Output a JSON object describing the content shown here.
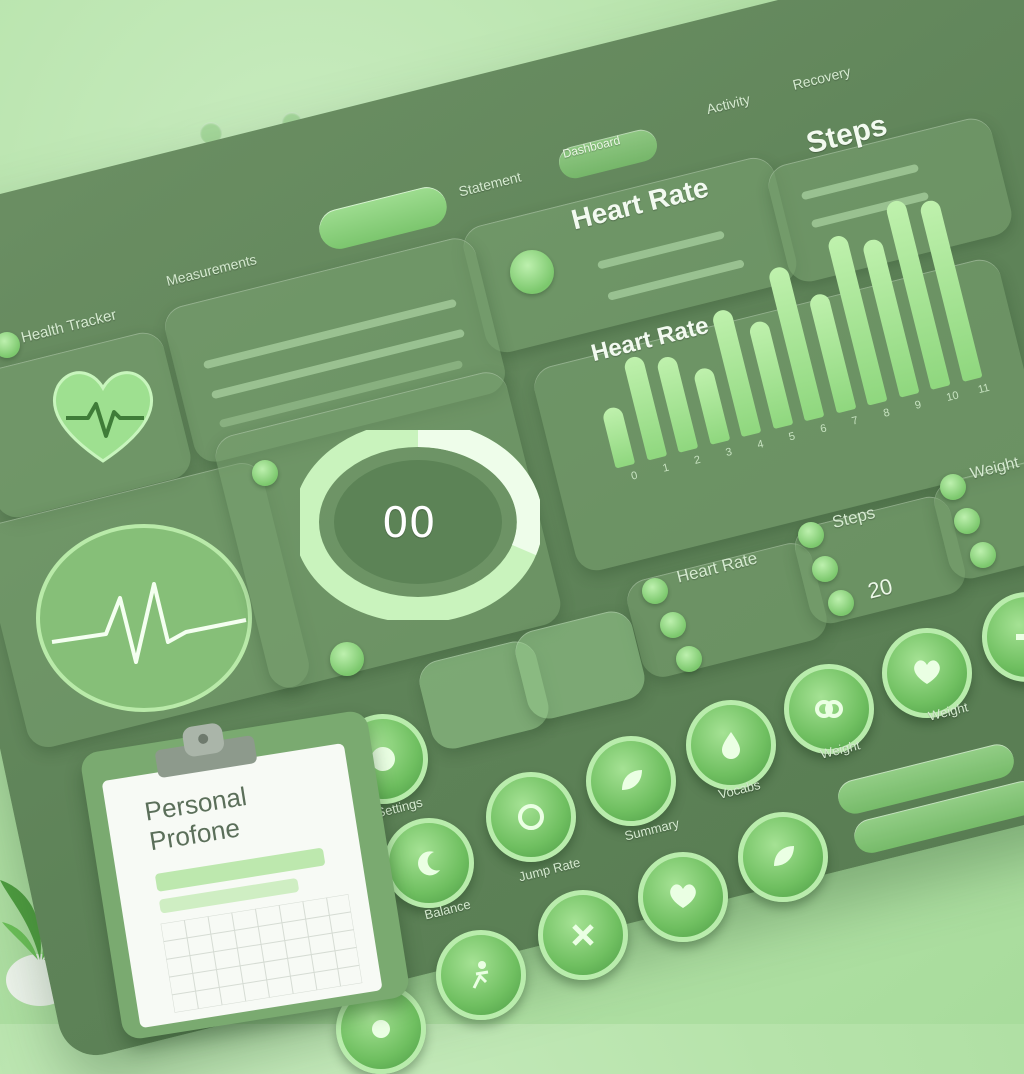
{
  "app": {
    "title": "Health Tracker"
  },
  "top_nav": {
    "items": [
      "Activity",
      "Recovery",
      "Statement",
      "Dashboard",
      "Measurements"
    ]
  },
  "cards": {
    "steps_title": "Steps",
    "heart_rate_title": "Heart Rate",
    "heart_rate_chart_title": "Heart Rate",
    "weight_title": "Weight",
    "steps_small_title": "Steps",
    "heart_rate_small_title": "Heart Rate",
    "steps_value": "20",
    "gauge_value": "00"
  },
  "buttons": {
    "labels": [
      "Weight",
      "Weight",
      "Vocabs",
      "Summary",
      "Jump Rate",
      "Balance",
      "Settings"
    ]
  },
  "profile": {
    "title_line1": "Personal",
    "title_line2": "Profone"
  },
  "chart_data": {
    "type": "bar",
    "title": "Heart Rate",
    "categories": [
      "0",
      "1",
      "2",
      "3",
      "4",
      "5",
      "6",
      "7",
      "8",
      "9",
      "10",
      "11"
    ],
    "values": [
      30,
      52,
      48,
      38,
      64,
      54,
      78,
      60,
      86,
      80,
      96,
      92
    ],
    "ylim": [
      0,
      100
    ],
    "grid": true
  },
  "colors": {
    "accent": "#8fd77e",
    "board": "#5e8358",
    "background": "#b6e3aa"
  }
}
